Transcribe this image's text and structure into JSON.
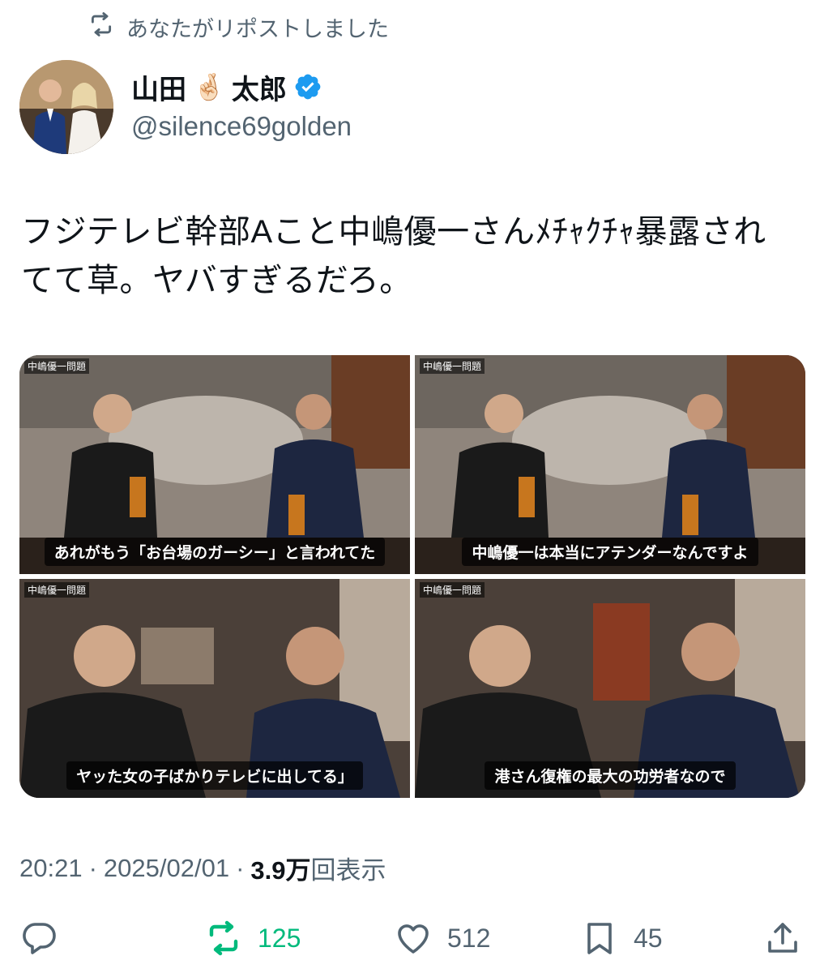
{
  "social_context": {
    "label": "あなたがリポストしました",
    "icon": "repost-icon"
  },
  "author": {
    "name_part1": "山田",
    "name_emoji": "🤞🏻",
    "name_part2": "太郎",
    "handle": "@silence69golden",
    "verified": true,
    "verified_color": "#1d9bf0"
  },
  "tweet": {
    "line1": "フジテレビ幹部Aこと中嶋優一さんﾒﾁｬｸﾁｬ暴露され",
    "line2": "てて草。ヤバすぎるだろ。"
  },
  "media": [
    {
      "tag": "中嶋優一問題",
      "caption": "あれがもう「お台場のガーシー」と言われてた"
    },
    {
      "tag": "中嶋優一問題",
      "caption": "中嶋優一は本当にアテンダーなんですよ"
    },
    {
      "tag": "中嶋優一問題",
      "caption": "ヤッた女の子ばかりテレビに出してる」"
    },
    {
      "tag": "中嶋優一問題",
      "caption": "港さん復権の最大の功労者なので"
    }
  ],
  "meta": {
    "time": "20:21",
    "sep1": "·",
    "date": "2025/02/01",
    "sep2": "·",
    "views_count": "3.9万",
    "views_label": "回表示"
  },
  "actions": {
    "reply": {
      "icon": "reply-icon",
      "count": ""
    },
    "repost": {
      "icon": "repost-icon",
      "count": "125",
      "active_color": "#00ba7c"
    },
    "like": {
      "icon": "heart-icon",
      "count": "512"
    },
    "bookmark": {
      "icon": "bookmark-icon",
      "count": "45"
    },
    "share": {
      "icon": "share-icon",
      "count": ""
    }
  }
}
